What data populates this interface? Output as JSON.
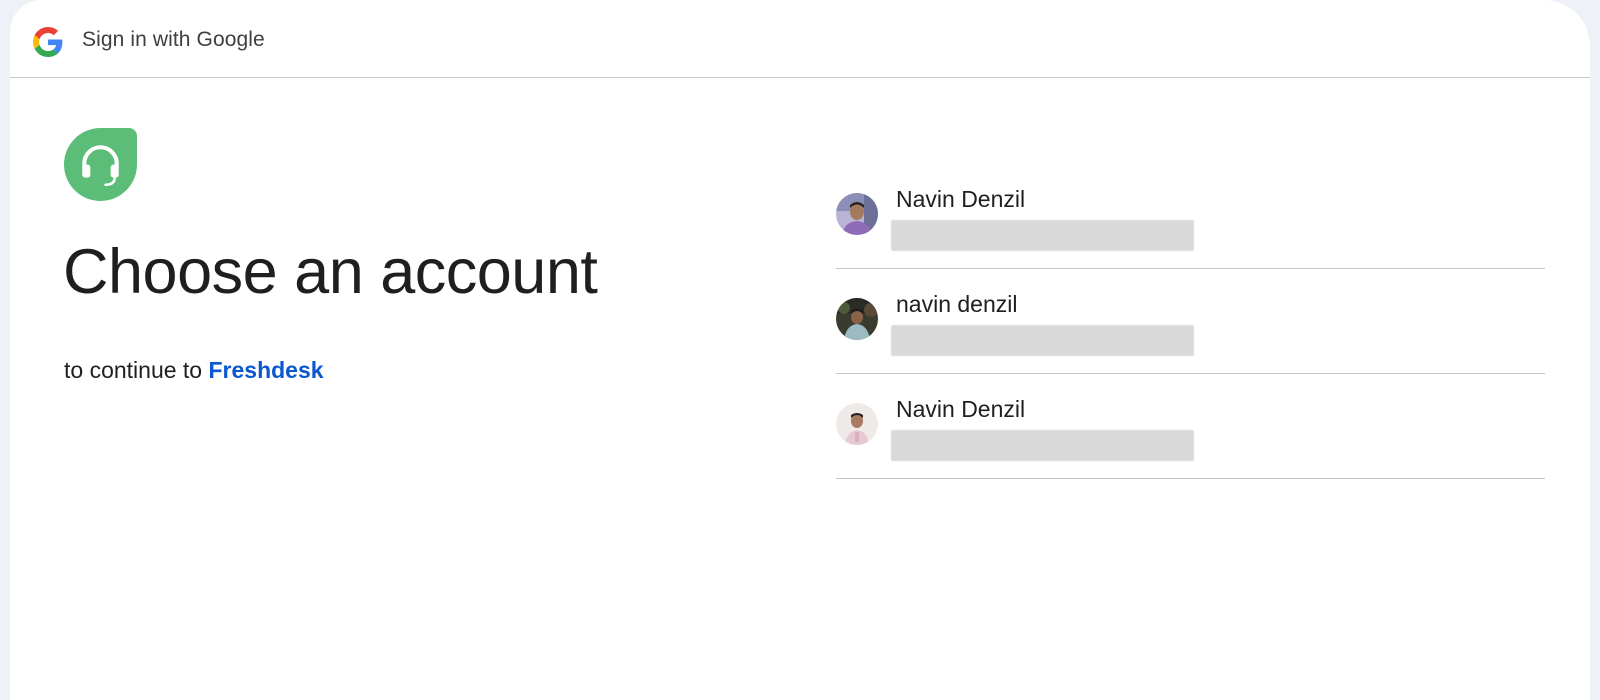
{
  "header": {
    "title": "Sign in with Google",
    "logo_icon": "google-g-icon"
  },
  "app": {
    "logo_icon": "freshdesk-headset-icon",
    "brand_color": "#5cbd78"
  },
  "main": {
    "title": "Choose an account",
    "subtitle_prefix": "to continue to",
    "app_name": "Freshdesk",
    "link_color": "#0b57d0"
  },
  "accounts": [
    {
      "name": "Navin Denzil",
      "avatar": "avatar-photo-icon"
    },
    {
      "name": "navin denzil",
      "avatar": "avatar-photo-icon"
    },
    {
      "name": "Navin Denzil",
      "avatar": "avatar-photo-icon"
    }
  ]
}
